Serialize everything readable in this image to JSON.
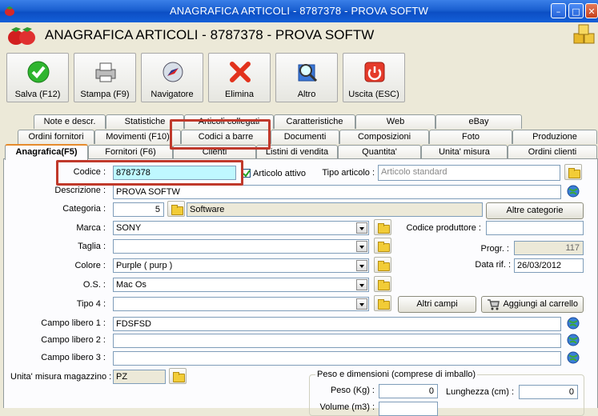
{
  "window": {
    "title": "ANAGRAFICA ARTICOLI - 8787378 - PROVA SOFTW"
  },
  "header": {
    "title": "ANAGRAFICA ARTICOLI - 8787378 - PROVA SOFTW"
  },
  "toolbar": {
    "save": "Salva (F12)",
    "print": "Stampa (F9)",
    "navigator": "Navigatore",
    "delete": "Elimina",
    "other": "Altro",
    "exit": "Uscita (ESC)"
  },
  "tabs": {
    "row1": [
      "Note e descr.",
      "Statistiche",
      "Articoli collegati",
      "Caratteristiche",
      "Web",
      "eBay"
    ],
    "row2": [
      "Ordini fornitori",
      "Movimenti (F10)",
      "Codici a barre",
      "Documenti",
      "Composizioni",
      "Foto",
      "Produzione"
    ],
    "row3": [
      "Anagrafica(F5)",
      "Fornitori (F6)",
      "Clienti",
      "Listini di vendita",
      "Quantita'",
      "Unita' misura",
      "Ordini clienti"
    ]
  },
  "form": {
    "codice_label": "Codice :",
    "codice_value": "8787378",
    "attivo_label": "Articolo attivo",
    "tipo_label": "Tipo articolo :",
    "tipo_placeholder": "Articolo standard",
    "descrizione_label": "Descrizione :",
    "descrizione_value": "PROVA SOFTW",
    "categoria_label": "Categoria :",
    "categoria_num": "5",
    "categoria_name": "Software",
    "altre_categorie": "Altre categorie",
    "marca_label": "Marca :",
    "marca_value": "SONY",
    "codice_produttore_label": "Codice produttore :",
    "taglia_label": "Taglia :",
    "progr_label": "Progr. :",
    "progr_value": "117",
    "colore_label": "Colore :",
    "colore_value": "Purple ( purp )",
    "data_rif_label": "Data rif. :",
    "data_rif_value": "26/03/2012",
    "os_label": "O.S. :",
    "os_value": "Mac Os",
    "tipo4_label": "Tipo 4 :",
    "altri_campi": "Altri campi",
    "aggiungi_carrello": "Aggiungi al carrello",
    "campo1_label": "Campo libero 1 :",
    "campo1_value": "FDSFSD",
    "campo2_label": "Campo libero 2 :",
    "campo3_label": "Campo libero 3 :",
    "um_label": "Unita' misura magazzino :",
    "um_value": "PZ",
    "peso_group": "Peso e dimensioni (comprese di imballo)",
    "peso_label": "Peso (Kg) :",
    "peso_value": "0",
    "lunghezza_label": "Lunghezza (cm) :",
    "lunghezza_value": "0",
    "volume_label": "Volume (m3) :"
  }
}
